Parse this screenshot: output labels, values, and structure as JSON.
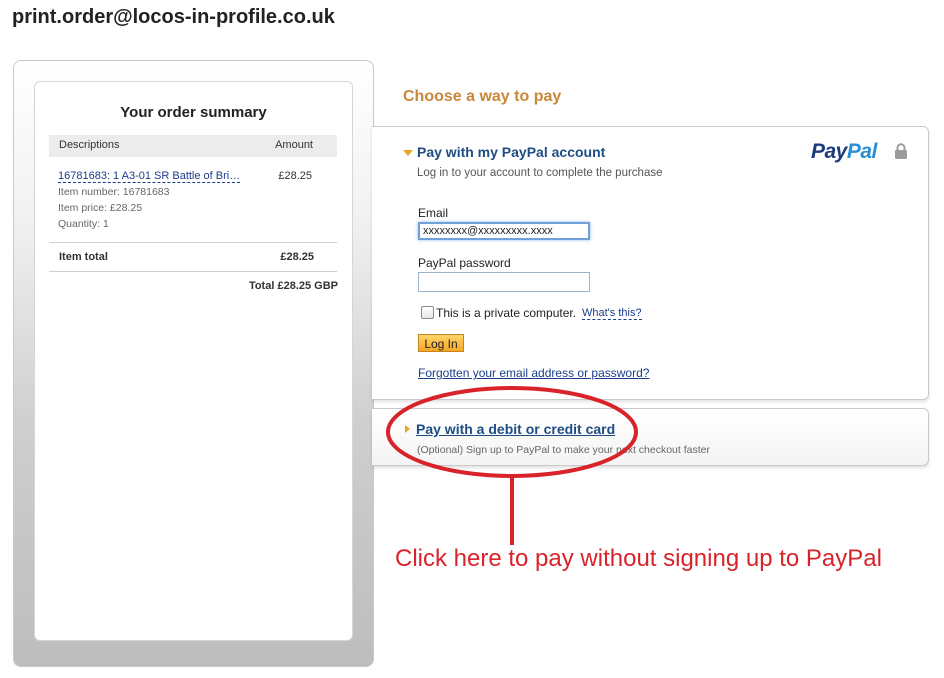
{
  "merchant": "print.order@locos-in-profile.co.uk",
  "summary": {
    "title": "Your order summary",
    "col_desc": "Descriptions",
    "col_amount": "Amount",
    "item": {
      "name": "16781683: 1 A3-01 SR Battle of Bri…",
      "price": "£28.25",
      "number": "Item number: 16781683",
      "item_price": "Item price: £28.25",
      "quantity": "Quantity: 1"
    },
    "item_total_label": "Item total",
    "item_total_value": "£28.25",
    "grand_total": "Total £28.25 GBP"
  },
  "choose": "Choose a way to pay",
  "paypal": {
    "title": "Pay with my PayPal account",
    "subtitle": "Log in to your account to complete the purchase",
    "logo_pay": "Pay",
    "logo_pal": "Pal",
    "email_label": "Email",
    "email_value": "xxxxxxxx@xxxxxxxxx.xxxx",
    "password_label": "PayPal password",
    "password_value": "",
    "private_label": "This is a private computer.",
    "whats_this": "What's this?",
    "login": "Log In",
    "forgot": "Forgotten your email address or password?"
  },
  "card": {
    "title": "Pay with a debit or credit card",
    "subtitle": "(Optional) Sign up to PayPal to make your next checkout faster"
  },
  "annotation": {
    "text": "Click here to pay without signing up to PayPal",
    "color": "#d8232a"
  },
  "colors": {
    "accent_orange": "#c9873a",
    "paypal_blue": "#1e4d83",
    "button_orange": "#f5a623"
  }
}
